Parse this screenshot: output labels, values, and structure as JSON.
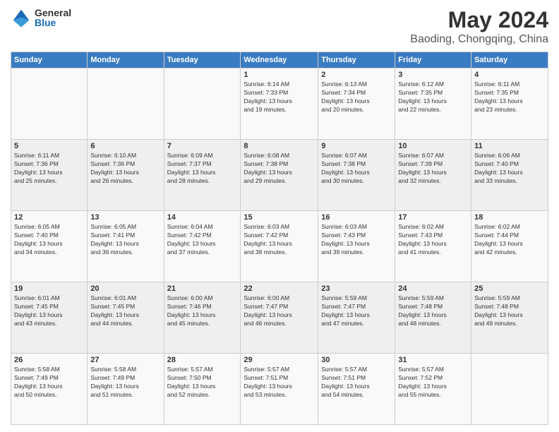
{
  "header": {
    "logo": {
      "general": "General",
      "blue": "Blue"
    },
    "title": "May 2024",
    "location": "Baoding, Chongqing, China"
  },
  "days_of_week": [
    "Sunday",
    "Monday",
    "Tuesday",
    "Wednesday",
    "Thursday",
    "Friday",
    "Saturday"
  ],
  "weeks": [
    [
      {
        "day": "",
        "info": ""
      },
      {
        "day": "",
        "info": ""
      },
      {
        "day": "",
        "info": ""
      },
      {
        "day": "1",
        "info": "Sunrise: 6:14 AM\nSunset: 7:33 PM\nDaylight: 13 hours\nand 19 minutes."
      },
      {
        "day": "2",
        "info": "Sunrise: 6:13 AM\nSunset: 7:34 PM\nDaylight: 13 hours\nand 20 minutes."
      },
      {
        "day": "3",
        "info": "Sunrise: 6:12 AM\nSunset: 7:35 PM\nDaylight: 13 hours\nand 22 minutes."
      },
      {
        "day": "4",
        "info": "Sunrise: 6:11 AM\nSunset: 7:35 PM\nDaylight: 13 hours\nand 23 minutes."
      }
    ],
    [
      {
        "day": "5",
        "info": "Sunrise: 6:11 AM\nSunset: 7:36 PM\nDaylight: 13 hours\nand 25 minutes."
      },
      {
        "day": "6",
        "info": "Sunrise: 6:10 AM\nSunset: 7:36 PM\nDaylight: 13 hours\nand 26 minutes."
      },
      {
        "day": "7",
        "info": "Sunrise: 6:09 AM\nSunset: 7:37 PM\nDaylight: 13 hours\nand 28 minutes."
      },
      {
        "day": "8",
        "info": "Sunrise: 6:08 AM\nSunset: 7:38 PM\nDaylight: 13 hours\nand 29 minutes."
      },
      {
        "day": "9",
        "info": "Sunrise: 6:07 AM\nSunset: 7:38 PM\nDaylight: 13 hours\nand 30 minutes."
      },
      {
        "day": "10",
        "info": "Sunrise: 6:07 AM\nSunset: 7:39 PM\nDaylight: 13 hours\nand 32 minutes."
      },
      {
        "day": "11",
        "info": "Sunrise: 6:06 AM\nSunset: 7:40 PM\nDaylight: 13 hours\nand 33 minutes."
      }
    ],
    [
      {
        "day": "12",
        "info": "Sunrise: 6:05 AM\nSunset: 7:40 PM\nDaylight: 13 hours\nand 34 minutes."
      },
      {
        "day": "13",
        "info": "Sunrise: 6:05 AM\nSunset: 7:41 PM\nDaylight: 13 hours\nand 36 minutes."
      },
      {
        "day": "14",
        "info": "Sunrise: 6:04 AM\nSunset: 7:42 PM\nDaylight: 13 hours\nand 37 minutes."
      },
      {
        "day": "15",
        "info": "Sunrise: 6:03 AM\nSunset: 7:42 PM\nDaylight: 13 hours\nand 38 minutes."
      },
      {
        "day": "16",
        "info": "Sunrise: 6:03 AM\nSunset: 7:43 PM\nDaylight: 13 hours\nand 39 minutes."
      },
      {
        "day": "17",
        "info": "Sunrise: 6:02 AM\nSunset: 7:43 PM\nDaylight: 13 hours\nand 41 minutes."
      },
      {
        "day": "18",
        "info": "Sunrise: 6:02 AM\nSunset: 7:44 PM\nDaylight: 13 hours\nand 42 minutes."
      }
    ],
    [
      {
        "day": "19",
        "info": "Sunrise: 6:01 AM\nSunset: 7:45 PM\nDaylight: 13 hours\nand 43 minutes."
      },
      {
        "day": "20",
        "info": "Sunrise: 6:01 AM\nSunset: 7:45 PM\nDaylight: 13 hours\nand 44 minutes."
      },
      {
        "day": "21",
        "info": "Sunrise: 6:00 AM\nSunset: 7:46 PM\nDaylight: 13 hours\nand 45 minutes."
      },
      {
        "day": "22",
        "info": "Sunrise: 6:00 AM\nSunset: 7:47 PM\nDaylight: 13 hours\nand 46 minutes."
      },
      {
        "day": "23",
        "info": "Sunrise: 5:59 AM\nSunset: 7:47 PM\nDaylight: 13 hours\nand 47 minutes."
      },
      {
        "day": "24",
        "info": "Sunrise: 5:59 AM\nSunset: 7:48 PM\nDaylight: 13 hours\nand 48 minutes."
      },
      {
        "day": "25",
        "info": "Sunrise: 5:59 AM\nSunset: 7:48 PM\nDaylight: 13 hours\nand 49 minutes."
      }
    ],
    [
      {
        "day": "26",
        "info": "Sunrise: 5:58 AM\nSunset: 7:49 PM\nDaylight: 13 hours\nand 50 minutes."
      },
      {
        "day": "27",
        "info": "Sunrise: 5:58 AM\nSunset: 7:49 PM\nDaylight: 13 hours\nand 51 minutes."
      },
      {
        "day": "28",
        "info": "Sunrise: 5:57 AM\nSunset: 7:50 PM\nDaylight: 13 hours\nand 52 minutes."
      },
      {
        "day": "29",
        "info": "Sunrise: 5:57 AM\nSunset: 7:51 PM\nDaylight: 13 hours\nand 53 minutes."
      },
      {
        "day": "30",
        "info": "Sunrise: 5:57 AM\nSunset: 7:51 PM\nDaylight: 13 hours\nand 54 minutes."
      },
      {
        "day": "31",
        "info": "Sunrise: 5:57 AM\nSunset: 7:52 PM\nDaylight: 13 hours\nand 55 minutes."
      },
      {
        "day": "",
        "info": ""
      }
    ]
  ]
}
